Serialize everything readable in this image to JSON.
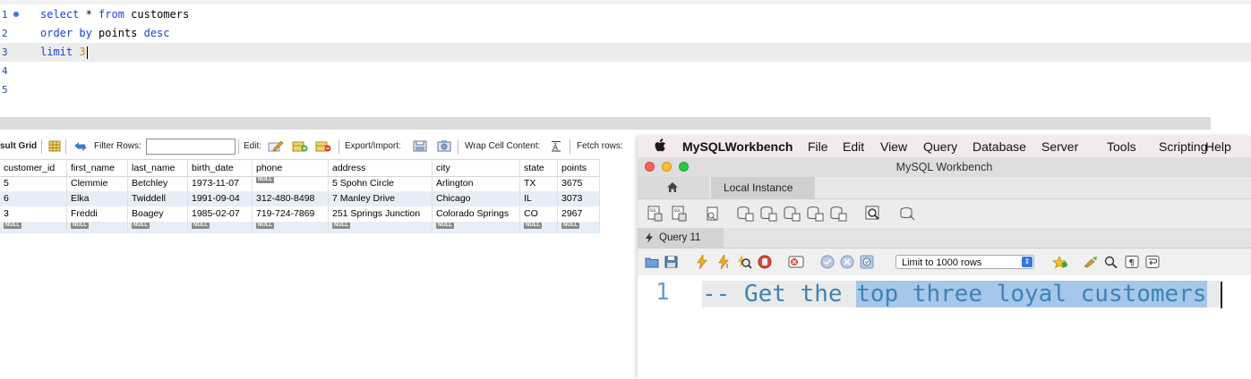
{
  "editor": {
    "lines": [
      {
        "num": "1",
        "parts": [
          {
            "t": "select",
            "c": "kw"
          },
          {
            "t": " * ",
            "c": "id"
          },
          {
            "t": "from",
            "c": "kw"
          },
          {
            "t": " customers",
            "c": "id"
          }
        ],
        "active": false,
        "marker": true
      },
      {
        "num": "2",
        "parts": [
          {
            "t": "order by",
            "c": "kw"
          },
          {
            "t": " points ",
            "c": "id"
          },
          {
            "t": "desc",
            "c": "kw"
          }
        ],
        "active": false,
        "marker": false
      },
      {
        "num": "3",
        "parts": [
          {
            "t": "limit",
            "c": "kw"
          },
          {
            "t": " ",
            "c": "id"
          },
          {
            "t": "3",
            "c": "num"
          }
        ],
        "active": true,
        "marker": false
      },
      {
        "num": "4",
        "parts": [],
        "active": false,
        "marker": false
      },
      {
        "num": "5",
        "parts": [],
        "active": false,
        "marker": false
      }
    ]
  },
  "result_toolbar": {
    "grid_label": "sult Grid",
    "filter_label": "Filter Rows:",
    "filter_value": "",
    "edit_label": "Edit:",
    "export_label": "Export/Import:",
    "wrap_label": "Wrap Cell Content:",
    "fetch_label": "Fetch rows:"
  },
  "grid": {
    "columns": [
      "customer_id",
      "first_name",
      "last_name",
      "birth_date",
      "phone",
      "address",
      "city",
      "state",
      "points"
    ],
    "rows": [
      [
        "5",
        "Clemmie",
        "Betchley",
        "1973-11-07",
        "NULL",
        "5 Spohn Circle",
        "Arlington",
        "TX",
        "3675"
      ],
      [
        "6",
        "Elka",
        "Twiddell",
        "1991-09-04",
        "312-480-8498",
        "7 Manley Drive",
        "Chicago",
        "IL",
        "3073"
      ],
      [
        "3",
        "Freddi",
        "Boagey",
        "1985-02-07",
        "719-724-7869",
        "251 Springs Junction",
        "Colorado Springs",
        "CO",
        "2967"
      ]
    ],
    "null_label": "NULL"
  },
  "workbench": {
    "menu": [
      "MySQLWorkbench",
      "File",
      "Edit",
      "View",
      "Query",
      "Database",
      "Server",
      "Tools",
      "Scripting",
      "Help"
    ],
    "window_title": "MySQL Workbench",
    "instance_tab": "Local Instance",
    "query_tab": "Query 11",
    "limit_select": "Limit to 1000 rows",
    "editor": {
      "line_num": "1",
      "plain_text": "-- Get the ",
      "selected_text": "top three loyal customers"
    },
    "colors": {
      "traffic_red": "#fd5f57",
      "traffic_yellow": "#febc2e",
      "traffic_green": "#28c840",
      "selection": "#a6c7ea"
    }
  }
}
